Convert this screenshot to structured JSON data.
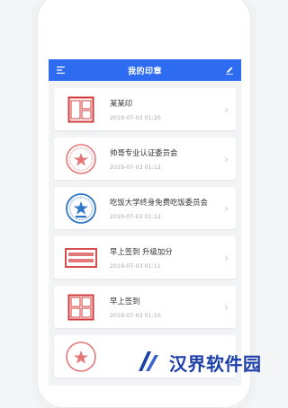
{
  "app": {
    "title": "我的印章"
  },
  "icons": {
    "menu": "menu-icon",
    "edit": "edit-icon",
    "chevron": "chevron-right-icon"
  },
  "colors": {
    "primary": "#2d6bf0",
    "seal_red": "#d23a3a",
    "seal_blue": "#2f76c9",
    "watermark_blue": "#1c3fa8"
  },
  "seals": [
    {
      "name": "某某印",
      "time": "2019-07-03 01:20",
      "seal_type": "square-red"
    },
    {
      "name": "帅哥专业认证委员会",
      "time": "2019-07-03 01:12",
      "seal_type": "round-red"
    },
    {
      "name": "吃饭大学终身免费吃饭委员会",
      "time": "2019-07-03 01:12",
      "seal_type": "round-blue"
    },
    {
      "name": "早上签到 升级加分",
      "time": "2019-07-03 01:11",
      "seal_type": "rect-red"
    },
    {
      "name": "早上签到",
      "time": "2019-07-03 01:10",
      "seal_type": "square-red"
    }
  ],
  "watermark": {
    "text": "汉界软件园"
  }
}
